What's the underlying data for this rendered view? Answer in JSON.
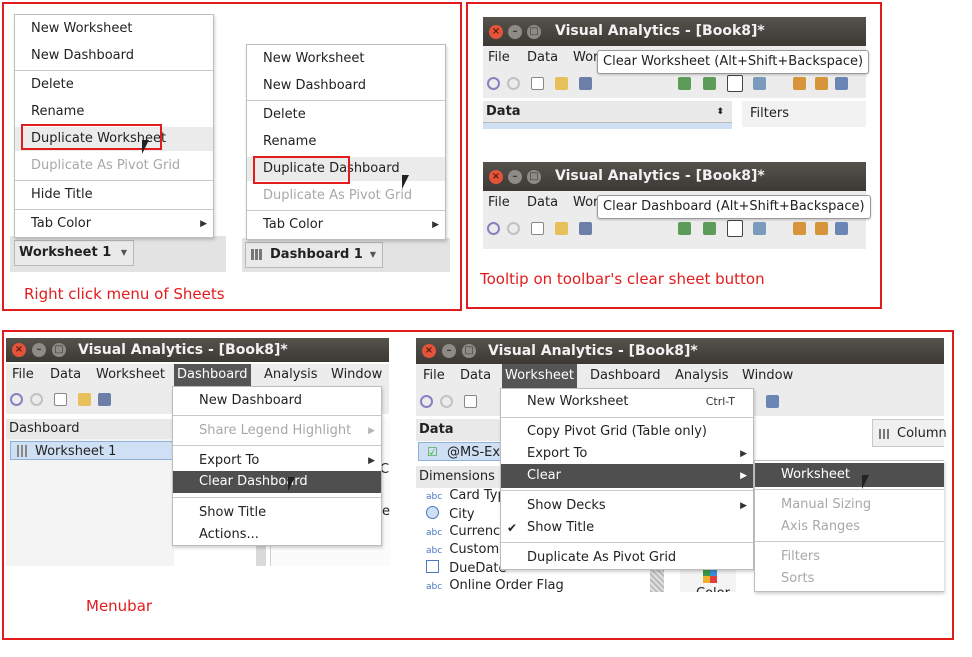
{
  "captions": {
    "right_click": "Right click menu of Sheets",
    "tooltip": "Tooltip on toolbar's clear sheet button",
    "menubar": "Menubar"
  },
  "worksheet_menu": {
    "items": [
      "New Worksheet",
      "New Dashboard",
      "Delete",
      "Rename",
      "Duplicate Worksheet",
      "Duplicate As Pivot Grid",
      "Hide Title",
      "Tab Color"
    ],
    "tab": "Worksheet 1"
  },
  "dashboard_menu": {
    "items": [
      "New Worksheet",
      "New Dashboard",
      "Delete",
      "Rename",
      "Duplicate Dashboard",
      "Duplicate As Pivot Grid",
      "Tab Color"
    ],
    "tab": "Dashboard 1"
  },
  "app": {
    "title": "Visual Analytics - [Book8]*"
  },
  "tooltips": {
    "top_menu": [
      "File",
      "Data",
      "Wor"
    ],
    "worksheet": "Clear Worksheet (Alt+Shift+Backspace)",
    "dashboard": "Clear Dashboard (Alt+Shift+Backspace)",
    "data_label": "Data",
    "filters_label": "Filters"
  },
  "menubar": {
    "items": [
      "File",
      "Data",
      "Worksheet",
      "Dashboard",
      "Analysis",
      "Window"
    ]
  },
  "dash_window": {
    "panel": "Dashboard",
    "row": "Worksheet 1",
    "menu": [
      "New Dashboard",
      "Share Legend Highlight",
      "Export To",
      "Clear Dashboard",
      "Show Title",
      "Actions..."
    ],
    "stub1": "C",
    "stub2": "e"
  },
  "ws_window": {
    "data_panel": "Data",
    "source": "@MS-Exc",
    "dimensions": "Dimensions",
    "fields": [
      {
        "type": "abc",
        "name": "Card Typ"
      },
      {
        "type": "globe",
        "name": "City"
      },
      {
        "type": "abc",
        "name": "Currency"
      },
      {
        "type": "abc",
        "name": "Custome"
      },
      {
        "type": "date",
        "name": "DueDate"
      },
      {
        "type": "abc",
        "name": "Online Order Flag"
      }
    ],
    "columns": "Column",
    "color_label": "Color",
    "menu": [
      "New Worksheet",
      "Copy Pivot Grid (Table only)",
      "Export To",
      "Clear",
      "Show Decks",
      "Show Title",
      "Duplicate As Pivot Grid"
    ],
    "shortcut": "Ctrl-T",
    "submenu": [
      "Worksheet",
      "Manual Sizing",
      "Axis Ranges",
      "Filters",
      "Sorts"
    ]
  },
  "icons": [
    "close-icon",
    "minimize-icon",
    "maximize-icon",
    "undo-icon",
    "redo-icon",
    "new-sheet-icon",
    "open-icon",
    "save-icon",
    "chevron-right-icon",
    "checkmark-icon",
    "cursor-icon",
    "grid-icon",
    "chart-icon",
    "globe-icon",
    "calendar-icon"
  ]
}
